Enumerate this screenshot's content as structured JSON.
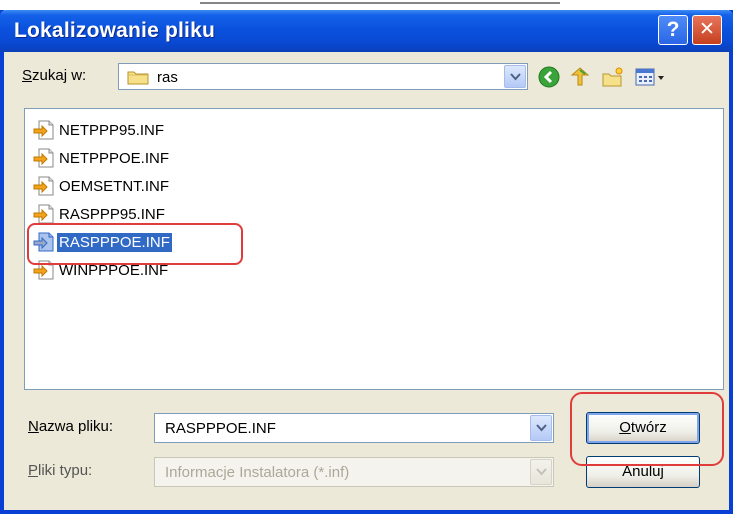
{
  "window": {
    "title": "Lokalizowanie pliku",
    "help_button": "?",
    "close_button": "✕"
  },
  "look_in": {
    "label_first": "S",
    "label_rest": "zukaj w:",
    "value": "ras"
  },
  "toolbar": {
    "icons": [
      "back-icon",
      "up-folder-icon",
      "new-folder-icon",
      "view-menu-icon"
    ]
  },
  "files": [
    {
      "name": "NETPPP95.INF"
    },
    {
      "name": "NETPPPOE.INF"
    },
    {
      "name": "OEMSETNT.INF"
    },
    {
      "name": "RASPPP95.INF"
    },
    {
      "name": "RASPPPOE.INF",
      "selected": true
    },
    {
      "name": "WINPPPOE.INF"
    }
  ],
  "file_name": {
    "label_first": "N",
    "label_rest": "azwa pliku:",
    "value": "RASPPPOE.INF"
  },
  "file_type": {
    "label_first": "P",
    "label_rest": "liki typu:",
    "value": "Informacje Instalatora (*.inf)"
  },
  "buttons": {
    "open_first": "O",
    "open_rest": "twórz",
    "cancel": "Anuluj"
  },
  "colors": {
    "titlebar": "#0a52de",
    "selection": "#316ac5",
    "highlight_box": "#e03c3c"
  }
}
